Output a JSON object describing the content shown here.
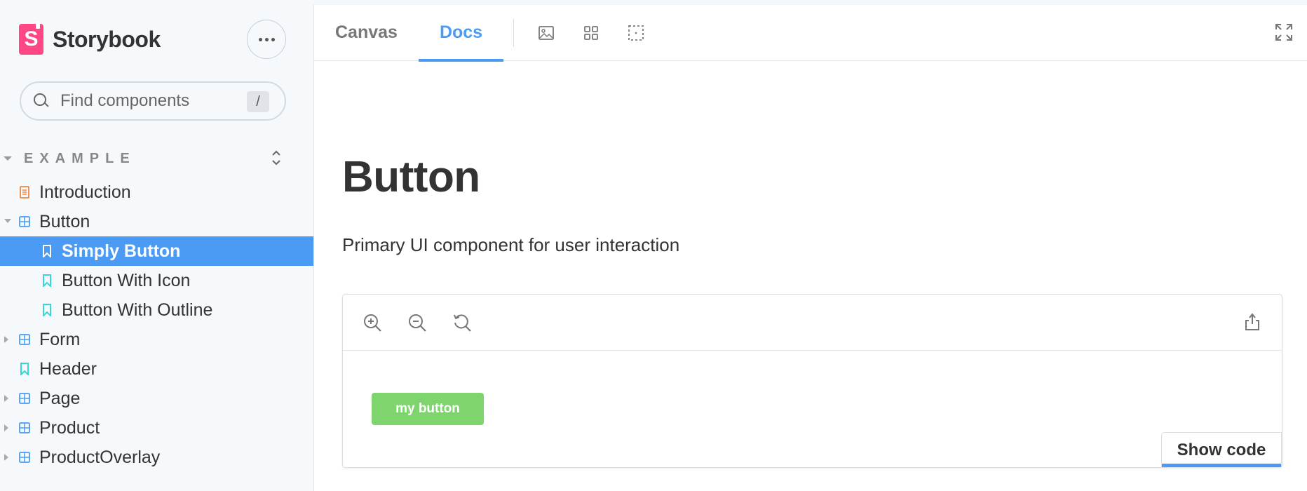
{
  "brand": {
    "name": "Storybook",
    "logo_letter": "S",
    "color": "#ff4785"
  },
  "search": {
    "placeholder": "Find components",
    "shortcut": "/"
  },
  "sidebar": {
    "group_label": "EXAMPLE",
    "items": [
      {
        "label": "Introduction",
        "icon": "document-icon",
        "level": 1
      },
      {
        "label": "Button",
        "icon": "component-icon",
        "level": 1,
        "expanded": true
      },
      {
        "label": "Simply Button",
        "icon": "bookmark-icon",
        "level": 2,
        "selected": true
      },
      {
        "label": "Button With Icon",
        "icon": "bookmark-icon",
        "level": 2
      },
      {
        "label": "Button With Outline",
        "icon": "bookmark-icon",
        "level": 2
      },
      {
        "label": "Form",
        "icon": "component-icon",
        "level": 1,
        "collapsed": true
      },
      {
        "label": "Header",
        "icon": "bookmark-icon",
        "level": 1
      },
      {
        "label": "Page",
        "icon": "component-icon",
        "level": 1,
        "collapsed": true
      },
      {
        "label": "Product",
        "icon": "component-icon",
        "level": 1,
        "collapsed": true
      },
      {
        "label": "ProductOverlay",
        "icon": "component-icon",
        "level": 1,
        "collapsed": true
      }
    ]
  },
  "toolbar": {
    "tabs": [
      {
        "label": "Canvas",
        "active": false
      },
      {
        "label": "Docs",
        "active": true
      }
    ],
    "tools": [
      "image-icon",
      "grid-icon",
      "outline-icon"
    ],
    "fullscreen_icon": "fullscreen-icon"
  },
  "docs": {
    "title": "Button",
    "description": "Primary UI component for user interaction",
    "preview": {
      "tools": [
        "zoom-in-icon",
        "zoom-out-icon",
        "reset-zoom-icon"
      ],
      "share_icon": "share-icon",
      "button_label": "my button",
      "show_code_label": "Show code"
    }
  },
  "colors": {
    "accent": "#4b9bf5",
    "sample_button": "#7ed46d",
    "sidebar_bg": "#f6f9fc"
  }
}
